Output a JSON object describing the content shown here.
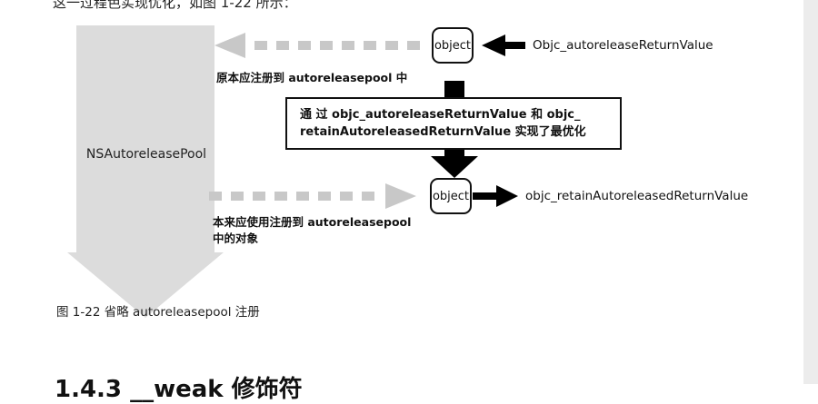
{
  "header_fragment": "这一过程色实现优化，如图 1-22 所示：",
  "pool_label": "NSAutoreleasePool",
  "object_label_top": "object",
  "object_label_bottom": "object",
  "func_top": "Objc_autoreleaseReturnValue",
  "func_bottom": "objc_retainAutoreleasedReturnValue",
  "note_top": "原本应注册到 autoreleasepool 中",
  "note_bottom_line1": "本来应使用注册到 autoreleasepool",
  "note_bottom_line2": "中的对象",
  "center_line1": "通 过 objc_autoreleaseReturnValue 和 objc_",
  "center_line2": "retainAutoreleasedReturnValue 实现了最优化",
  "caption": "图 1-22   省略 autoreleasepool 注册",
  "next_section": "1.4.3   __weak 修饰符",
  "colors": {
    "pool_fill": "#d9d9d9",
    "dashed_arrow": "#c9c9c9",
    "solid_arrow": "#000000"
  }
}
